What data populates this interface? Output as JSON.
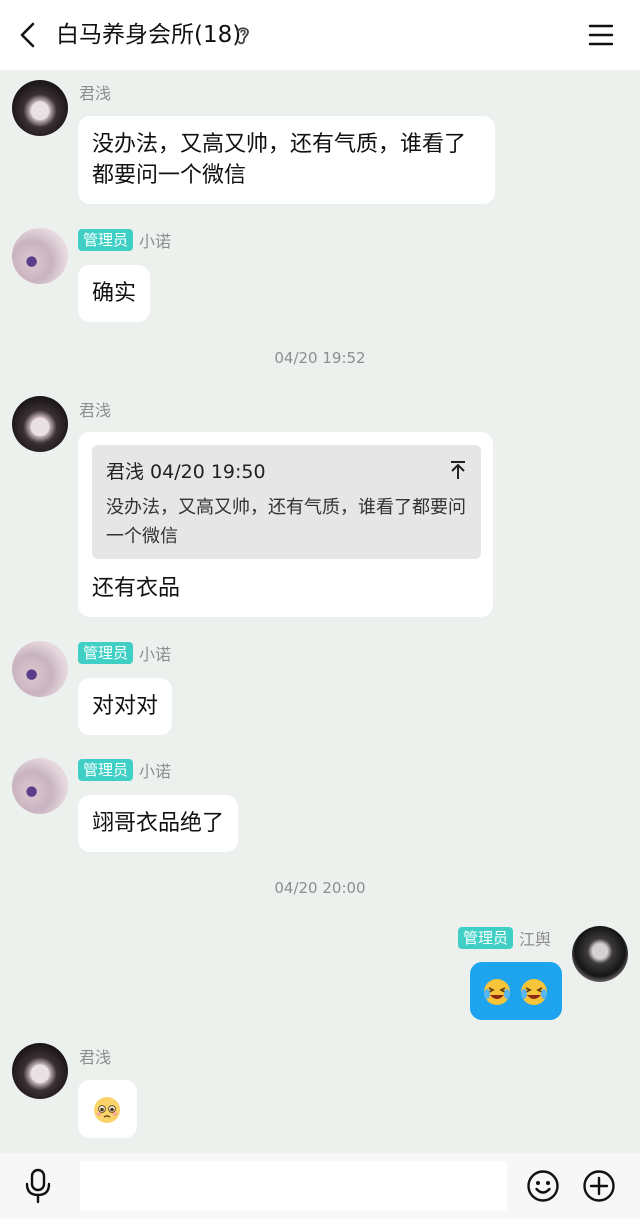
{
  "header": {
    "title": "白马养身会所(18)",
    "back_icon": "chevron-left-icon",
    "ear_icon": "ear-icon",
    "menu_icon": "hamburger-menu-icon"
  },
  "messages": [
    {
      "sender": "君浅",
      "admin": false,
      "text": "没办法，又高又帅，还有气质，谁看了都要问一个微信"
    },
    {
      "sender": "小诺",
      "admin": true,
      "badge": "管理员",
      "text": "确实"
    },
    {
      "type": "timestamp",
      "text": "04/20 19:52"
    },
    {
      "sender": "君浅",
      "admin": false,
      "quote": {
        "head": "君浅 04/20 19:50",
        "text": "没办法，又高又帅，还有气质，谁看了都要问一个微信"
      },
      "text": "还有衣品"
    },
    {
      "sender": "小诺",
      "admin": true,
      "badge": "管理员",
      "text": "对对对"
    },
    {
      "sender": "小诺",
      "admin": true,
      "badge": "管理员",
      "text": "翊哥衣品绝了"
    },
    {
      "type": "timestamp",
      "text": "04/20 20:00"
    },
    {
      "sender": "江舆",
      "admin": true,
      "badge": "管理员",
      "self": true,
      "emoji": [
        "laughing-crying-emoji",
        "laughing-crying-emoji"
      ]
    },
    {
      "sender": "君浅",
      "admin": false,
      "emoji": [
        "pleading-face-emoji"
      ]
    }
  ],
  "input_bar": {
    "mic_icon": "microphone-icon",
    "placeholder": "",
    "smile_icon": "emoji-smile-icon",
    "plus_icon": "plus-circle-icon"
  },
  "colors": {
    "background": "#edf1ed",
    "admin_badge": "#3fcfc4",
    "self_bubble": "#1ea4ee"
  }
}
